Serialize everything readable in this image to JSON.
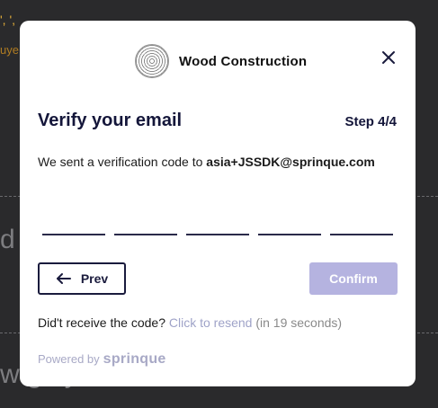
{
  "background": {
    "line1": "', ',",
    "line2": "uye",
    "big_char_1": "d",
    "big_char_2": "w          gh y"
  },
  "brand": {
    "name": "Wood Construction"
  },
  "modal": {
    "title": "Verify your email",
    "step": "Step 4/4",
    "message_prefix": "We sent a verification code to",
    "email": "asia+JSSDK@sprinque.com",
    "code_fields": [
      "",
      "",
      "",
      "",
      ""
    ],
    "prev_label": "Prev",
    "confirm_label": "Confirm",
    "resend_prompt": "Did't receive the code?",
    "resend_link": "Click to resend",
    "resend_timer": "(in 19 seconds)",
    "powered_by": "Powered by",
    "powered_brand": "sprinque"
  },
  "colors": {
    "accent_navy": "#14163a",
    "confirm_disabled": "#b5b3e0",
    "link": "#9fa3c8"
  },
  "icons": {
    "close": "close-icon",
    "back_arrow": "arrow-left-icon",
    "logo": "wood-logo-icon"
  }
}
